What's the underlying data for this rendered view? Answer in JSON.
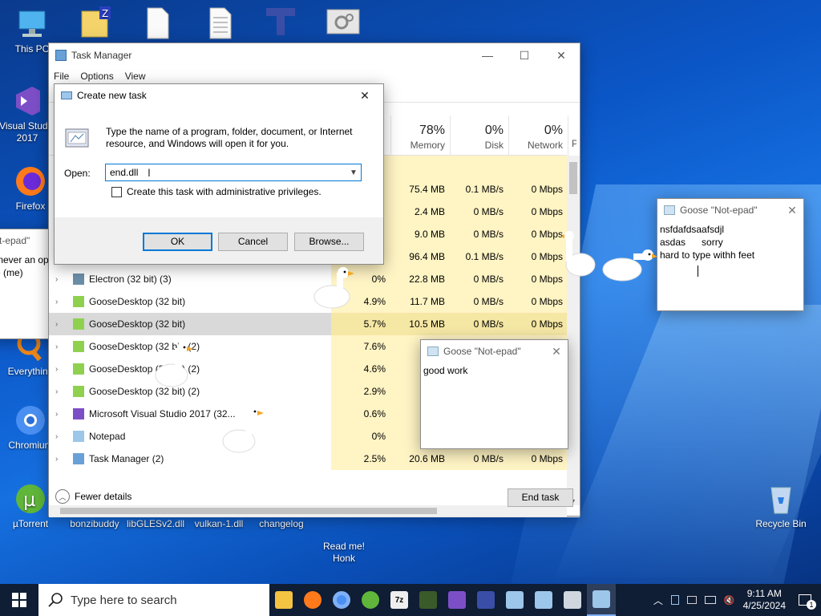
{
  "desktop_icons": [
    {
      "label": "This PC",
      "icon": "this-pc-icon"
    },
    {
      "label": "Visual Studio 2017",
      "icon": "visual-studio-icon"
    },
    {
      "label": "Firefox",
      "icon": "firefox-icon"
    },
    {
      "label": "Everything",
      "icon": "everything-icon"
    },
    {
      "label": "Chromium",
      "icon": "chromium-icon"
    },
    {
      "label": "µTorrent",
      "icon": "utorrent-icon"
    },
    {
      "label": "bonzibuddy",
      "icon": "file-icon"
    },
    {
      "label": "libGLESv2.dll",
      "icon": "dll-icon"
    },
    {
      "label": "vulkan-1.dll",
      "icon": "dll-icon"
    },
    {
      "label": "changelog",
      "icon": "text-file-icon"
    },
    {
      "label": "Read me!\nHonk",
      "icon": "text-file-icon"
    },
    {
      "label": "Recycle Bin",
      "icon": "recycle-bin-icon"
    }
  ],
  "task_manager": {
    "title": "Task Manager",
    "menu": [
      "File",
      "Options",
      "View"
    ],
    "columns": {
      "memory": {
        "pct": "78%",
        "name": "Memory"
      },
      "disk": {
        "pct": "0%",
        "name": "Disk"
      },
      "network": {
        "pct": "0%",
        "name": "Network"
      },
      "power_initial": "P"
    },
    "rows": [
      {
        "name": "",
        "cpu": "",
        "memory": "75.4 MB",
        "disk": "0.1 MB/s",
        "network": "0 Mbps"
      },
      {
        "name": "",
        "cpu": "",
        "memory": "2.4 MB",
        "disk": "0 MB/s",
        "network": "0 Mbps"
      },
      {
        "name": "",
        "cpu": "",
        "memory": "9.0 MB",
        "disk": "0 MB/s",
        "network": "0 Mbps"
      },
      {
        "name": "",
        "cpu": "",
        "memory": "96.4 MB",
        "disk": "0.1 MB/s",
        "network": "0 Mbps"
      },
      {
        "name": "Electron (32 bit) (3)",
        "cpu": "0%",
        "memory": "22.8 MB",
        "disk": "0 MB/s",
        "network": "0 Mbps"
      },
      {
        "name": "GooseDesktop (32 bit)",
        "cpu": "4.9%",
        "memory": "11.7 MB",
        "disk": "0 MB/s",
        "network": "0 Mbps"
      },
      {
        "name": "GooseDesktop (32 bit)",
        "cpu": "5.7%",
        "memory": "10.5 MB",
        "disk": "0 MB/s",
        "network": "0 Mbps"
      },
      {
        "name": "GooseDesktop (32 bit) (2)",
        "cpu": "7.6%",
        "memory": "10",
        "disk": "",
        "network": ""
      },
      {
        "name": "GooseDesktop (32 bit) (2)",
        "cpu": "4.6%",
        "memory": "11",
        "disk": "",
        "network": ""
      },
      {
        "name": "GooseDesktop (32 bit) (2)",
        "cpu": "2.9%",
        "memory": "11",
        "disk": "",
        "network": ""
      },
      {
        "name": "Microsoft Visual Studio 2017 (32...",
        "cpu": "0.6%",
        "memory": "191",
        "disk": "",
        "network": ""
      },
      {
        "name": "Notepad",
        "cpu": "0%",
        "memory": "1",
        "disk": "",
        "network": ""
      },
      {
        "name": "Task Manager (2)",
        "cpu": "2.5%",
        "memory": "20.6 MB",
        "disk": "0 MB/s",
        "network": "0 Mbps"
      }
    ],
    "fewer_details": "Fewer details",
    "end_task": "End task"
  },
  "dialog": {
    "title": "Create new task",
    "description": "Type the name of a program, folder, document, or Internet resource, and Windows will open it for you.",
    "open_label": "Open:",
    "open_value": "end.dll",
    "admin_checkbox_label": "Create this task with administrative privileges.",
    "admin_checked": false,
    "ok": "OK",
    "cancel": "Cancel",
    "browse": "Browse..."
  },
  "goose_notes": [
    {
      "title": "Goose \"Not-epad\"",
      "text": "nsfdafdsaafsdjl\nasdas      sorry\nhard to type withh feet"
    },
    {
      "title": "Goose \"Not-epad\"",
      "text": "good work"
    },
    {
      "title": "t-epad\"",
      "text": " never an option\"\ne (me)"
    }
  ],
  "taskbar": {
    "search_placeholder": "Type here to search",
    "time": "9:11 AM",
    "date": "4/25/2024",
    "notification_count": "1"
  }
}
